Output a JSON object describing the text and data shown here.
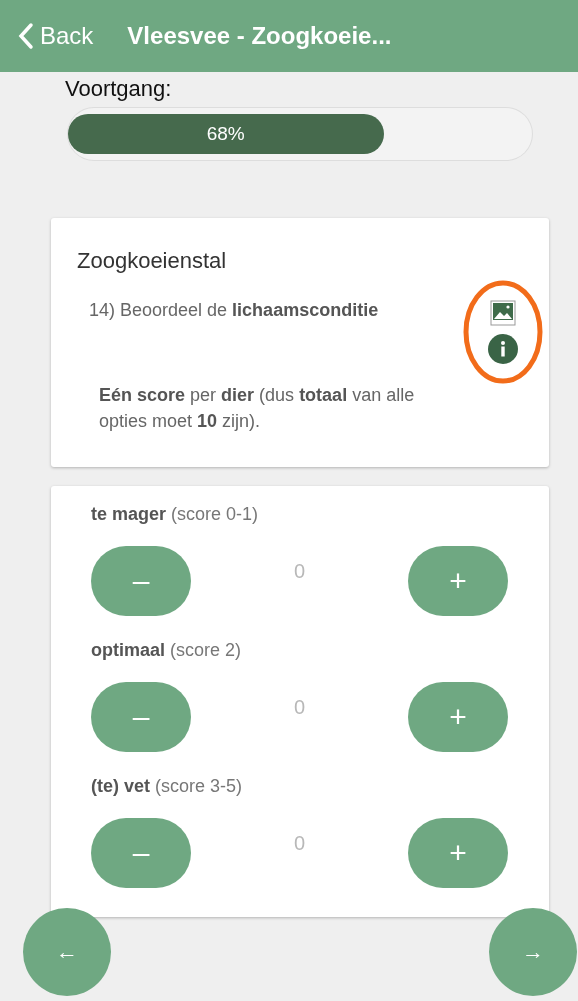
{
  "header": {
    "back": "Back",
    "title": "Vleesvee - Zoogkoeie..."
  },
  "progress": {
    "label": "Voortgang:",
    "level": 0.68,
    "reading": "68%"
  },
  "question": {
    "section": "Zoogkoeienstal",
    "text": "14) Beoordeel de **lichaamsconditie**",
    "note": "**Eén score** per **dier** (dus **totaal** van alle opties moet **10** zijn).",
    "highlighted": true
  },
  "options": [
    {
      "label": "**te mager** (score 0-1)",
      "minus": "–",
      "value": "0",
      "plus": "+"
    },
    {
      "label": "**optimaal** (score 2)",
      "minus": "–",
      "value": "0",
      "plus": "+"
    },
    {
      "label": "**(te) vet** (score 3-5)",
      "minus": "–",
      "value": "0",
      "plus": "+"
    }
  ],
  "nav": {
    "previous": "←",
    "next": "→"
  }
}
